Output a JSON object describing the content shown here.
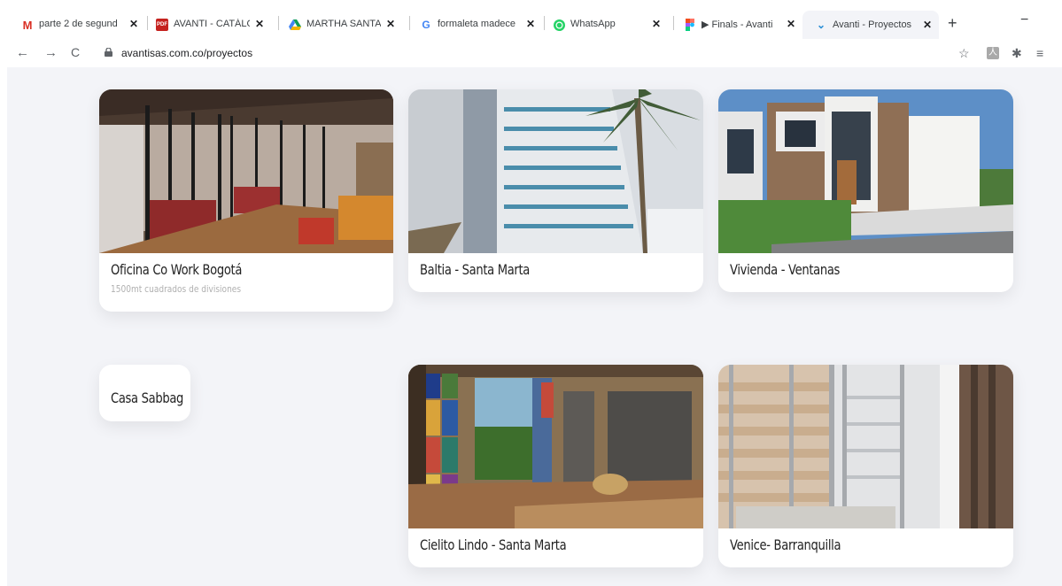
{
  "browser": {
    "tabs": [
      {
        "title": "parte 2 de segund",
        "icon": "gmail-icon",
        "active": false
      },
      {
        "title": "AVANTI - CATÁLOG",
        "icon": "pdf-icon",
        "active": false
      },
      {
        "title": "MARTHA SANTA",
        "icon": "drive-icon",
        "active": false
      },
      {
        "title": "formaleta madece",
        "icon": "google-icon",
        "active": false
      },
      {
        "title": "WhatsApp",
        "icon": "whatsapp-icon",
        "active": false
      },
      {
        "title": "▶ Finals - Avanti",
        "icon": "figma-icon",
        "active": false
      },
      {
        "title": "Avanti - Proyectos",
        "icon": "avanti-icon",
        "active": true
      }
    ],
    "url": "avantisas.com.co/proyectos"
  },
  "projects": [
    {
      "title": "Oficina Co Work Bogotá",
      "subtitle": "1500mt cuadrados de divisiones"
    },
    {
      "title": "Baltia - Santa Marta"
    },
    {
      "title": "Vivienda - Ventanas"
    },
    {
      "title": "Casa Sabbag"
    },
    {
      "title": "Cielito Lindo - Santa Marta"
    },
    {
      "title": "Venice- Barranquilla"
    }
  ]
}
